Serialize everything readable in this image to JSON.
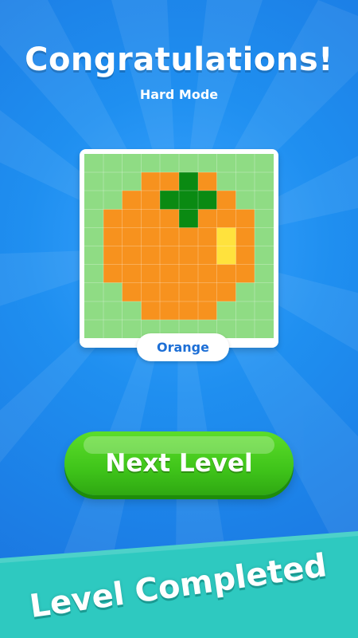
{
  "screen": {
    "title": "Congratulations!",
    "subtitle": "Hard Mode"
  },
  "puzzle": {
    "name": "Orange",
    "difficulty": "Hard Mode",
    "grid_size": [
      10,
      10
    ],
    "colors": {
      "background": "#8fdc84",
      "orange": "#f7921e",
      "leaf": "#0a8a12",
      "highlight": "#ffe23d"
    }
  },
  "actions": {
    "next_label": "Next Level"
  },
  "banner": {
    "text": "Level Completed",
    "color": "#2ec9c0"
  },
  "theme": {
    "background": "#1f8ff0",
    "button_green": "#3fc41a",
    "label_blue": "#1d6fd6"
  }
}
